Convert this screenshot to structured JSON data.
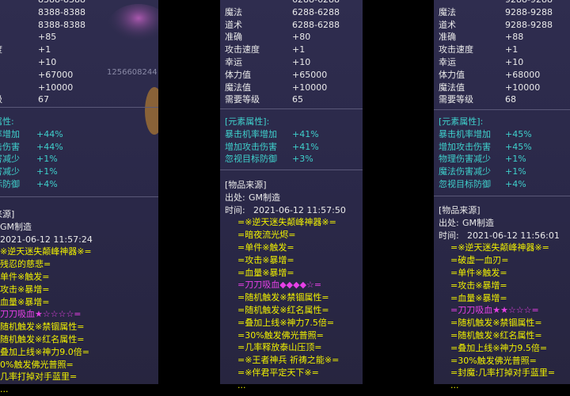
{
  "panels": [
    {
      "stats_top": [
        {
          "label": "",
          "value": "8388-8388"
        },
        {
          "label": "",
          "value": "8388-8388"
        },
        {
          "label": "",
          "value": "8388-8388"
        },
        {
          "label": "",
          "value": "+85"
        },
        {
          "label": "度",
          "value": "+1"
        },
        {
          "label": "",
          "value": "+10"
        },
        {
          "label": "",
          "value": "+67000"
        },
        {
          "label": "",
          "value": "+10000"
        },
        {
          "label": "级",
          "value": "67"
        }
      ],
      "side_number": "1256608244",
      "element_header": "属性:",
      "elements": [
        {
          "label": "率增加",
          "value": "+44%"
        },
        {
          "label": "击伤害",
          "value": "+44%"
        },
        {
          "label": "害减少",
          "value": "+1%"
        },
        {
          "label": "害减少",
          "value": "+1%"
        },
        {
          "label": "标防御",
          "value": "+4%"
        }
      ],
      "source_header": "来源]",
      "source_from": "GM制造",
      "source_time": "2021-06-12 11:57:24",
      "lines": [
        {
          "text": "※逆天迷失颠峰神器※=",
          "color": "y"
        },
        {
          "text": "残忍的慈悲=",
          "color": "y"
        },
        {
          "text": "单件※触发=",
          "color": "y"
        },
        {
          "text": "攻击※暴增=",
          "color": "y"
        },
        {
          "text": "血量※暴增=",
          "color": "y"
        },
        {
          "text": "刀刀吸血★☆☆☆☆=",
          "color": "m"
        },
        {
          "text": "随机触发※禁锢属性=",
          "color": "y"
        },
        {
          "text": "随机触发※红名属性=",
          "color": "y"
        },
        {
          "text": "叠加上线※神力9.0倍=",
          "color": "y"
        },
        {
          "text": "0%触发佛光普照=",
          "color": "y"
        },
        {
          "text": "几率打掉对手蓝里=",
          "color": "y"
        },
        {
          "text": "...",
          "color": "y"
        }
      ]
    },
    {
      "stats_top": [
        {
          "label": "",
          "value": "6288-6288"
        },
        {
          "label": "魔法",
          "value": "6288-6288"
        },
        {
          "label": "道术",
          "value": "6288-6288"
        },
        {
          "label": "准确",
          "value": "+80"
        },
        {
          "label": "攻击速度",
          "value": "+1"
        },
        {
          "label": "幸运",
          "value": "+10"
        },
        {
          "label": "体力值",
          "value": "+65000"
        },
        {
          "label": "魔法值",
          "value": "+10000"
        },
        {
          "label": "需要等级",
          "value": "65"
        }
      ],
      "element_header": "[元素属性]:",
      "elements": [
        {
          "label": "暴击机率增加",
          "value": "+41%"
        },
        {
          "label": "增加攻击伤害",
          "value": "+41%"
        },
        {
          "label": "忽视目标防御",
          "value": "+3%"
        }
      ],
      "source_header": "[物品来源]",
      "source_from_label": "出处:",
      "source_from": "GM制造",
      "source_time_label": "时间:",
      "source_time": "2021-06-12 11:57:50",
      "lines": [
        {
          "text": "=※逆天迷失颠峰神器※=",
          "color": "y"
        },
        {
          "text": "=暗夜流光烬=",
          "color": "y"
        },
        {
          "text": "=单件※触发=",
          "color": "y"
        },
        {
          "text": "=攻击※暴增=",
          "color": "y"
        },
        {
          "text": "=血量※暴增=",
          "color": "y"
        },
        {
          "text": "=刀刀吸血◆◆◆◆☆=",
          "color": "m"
        },
        {
          "text": "=随机触发※禁锢属性=",
          "color": "y"
        },
        {
          "text": "=随机触发※红名属性=",
          "color": "y"
        },
        {
          "text": "=叠加上线※神力7.5倍=",
          "color": "y"
        },
        {
          "text": "=30%触发佛光普照=",
          "color": "y"
        },
        {
          "text": "=几率释放泰山压顶=",
          "color": "y"
        },
        {
          "text": "=※王者神兵 祈祷之能※=",
          "color": "y"
        },
        {
          "text": "=※伴君平定天下※=",
          "color": "y"
        },
        {
          "text": "...",
          "color": "y"
        }
      ]
    },
    {
      "stats_top": [
        {
          "label": "",
          "value": "9288-9288"
        },
        {
          "label": "魔法",
          "value": "9288-9288"
        },
        {
          "label": "道术",
          "value": "9288-9288"
        },
        {
          "label": "准确",
          "value": "+88"
        },
        {
          "label": "攻击速度",
          "value": "+1"
        },
        {
          "label": "幸运",
          "value": "+10"
        },
        {
          "label": "体力值",
          "value": "+68000"
        },
        {
          "label": "魔法值",
          "value": "+10000"
        },
        {
          "label": "需要等级",
          "value": "68"
        }
      ],
      "element_header": "[元素属性]:",
      "elements": [
        {
          "label": "暴击机率增加",
          "value": "+45%"
        },
        {
          "label": "增加攻击伤害",
          "value": "+45%"
        },
        {
          "label": "物理伤害减少",
          "value": "+1%"
        },
        {
          "label": "魔法伤害减少",
          "value": "+1%"
        },
        {
          "label": "忽视目标防御",
          "value": "+4%"
        }
      ],
      "source_header": "[物品来源]",
      "source_from_label": "出处:",
      "source_from": "GM制造",
      "source_time_label": "时间:",
      "source_time": "2021-06-12 11:56:01",
      "lines": [
        {
          "text": "=※逆天迷失颠峰神器※=",
          "color": "y"
        },
        {
          "text": "=破虚一血刃=",
          "color": "y"
        },
        {
          "text": "=单件※触发=",
          "color": "y"
        },
        {
          "text": "=攻击※暴增=",
          "color": "y"
        },
        {
          "text": "=血量※暴增=",
          "color": "y"
        },
        {
          "text": "=刀刀吸血★★☆☆☆=",
          "color": "m"
        },
        {
          "text": "=随机触发※禁锢属性=",
          "color": "y"
        },
        {
          "text": "=随机触发※红名属性=",
          "color": "y"
        },
        {
          "text": "=叠加上线※神力9.5倍=",
          "color": "y"
        },
        {
          "text": "=30%触发佛光普照=",
          "color": "y"
        },
        {
          "text": "=封魔:几率打掉对手蓝里=",
          "color": "y"
        },
        {
          "text": "...",
          "color": "y"
        }
      ]
    }
  ]
}
